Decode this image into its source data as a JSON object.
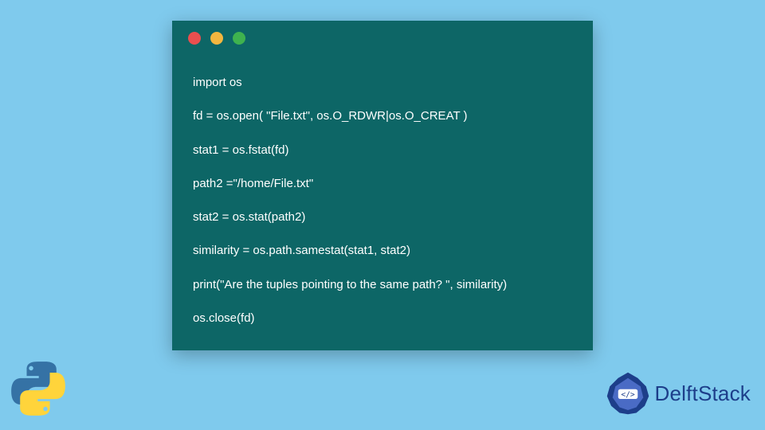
{
  "code": {
    "lines": [
      "import os",
      "fd = os.open( \"File.txt\", os.O_RDWR|os.O_CREAT )",
      "stat1 = os.fstat(fd)",
      "path2 =\"/home/File.txt\"",
      "stat2 = os.stat(path2)",
      "similarity = os.path.samestat(stat1, stat2)",
      "print(\"Are the tuples pointing to the same path? \", similarity)",
      "os.close(fd)"
    ]
  },
  "window": {
    "dots": [
      "red",
      "yellow",
      "green"
    ]
  },
  "brand": {
    "name": "DelftStack"
  },
  "colors": {
    "page_bg": "#7fcaed",
    "window_bg": "#0d6666",
    "code_fg": "#ffffff",
    "brand_fg": "#1d3e8a"
  }
}
